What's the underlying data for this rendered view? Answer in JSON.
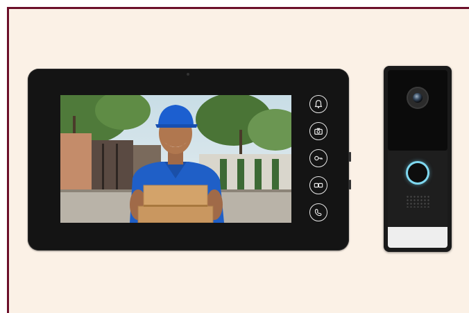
{
  "colors": {
    "frame_border": "#6b0f2a",
    "background": "#fbf1e6",
    "device_body": "#141414",
    "call_button_glow": "#7fd8f0"
  },
  "monitor": {
    "buttons": [
      {
        "icon": "bell-icon"
      },
      {
        "icon": "camera-icon"
      },
      {
        "icon": "key-unlock-icon"
      },
      {
        "icon": "intercom-icon"
      },
      {
        "icon": "phone-handset-icon"
      }
    ]
  },
  "doorbell": {
    "icons": [
      "camera-lens-icon",
      "call-button-icon",
      "speaker-grille-icon"
    ]
  }
}
